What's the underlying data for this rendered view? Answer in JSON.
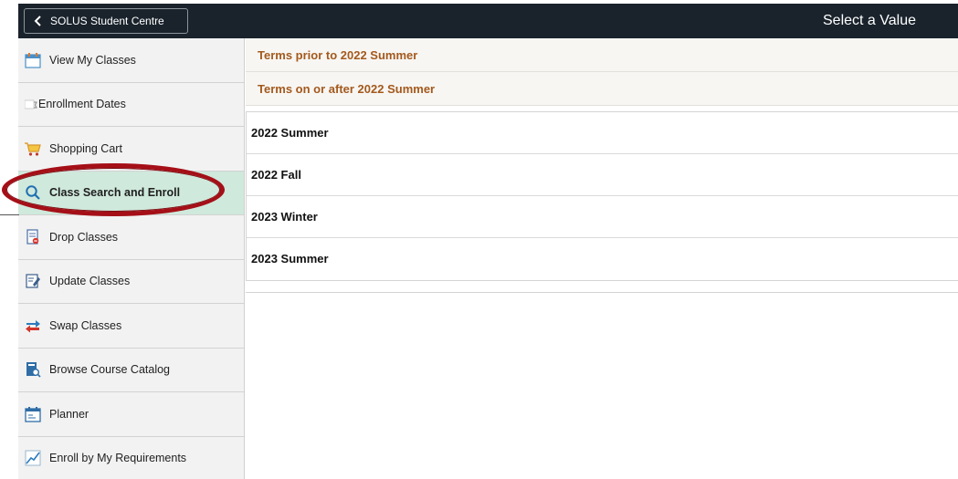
{
  "topbar": {
    "back_label": "SOLUS Student Centre",
    "title": "Select a Value"
  },
  "sidebar": {
    "items": [
      {
        "label": "View My Classes",
        "icon": "calendar-icon"
      },
      {
        "label": "Enrollment Dates",
        "icon": "hourglass-icon"
      },
      {
        "label": "Shopping Cart",
        "icon": "shopping-cart-icon"
      },
      {
        "label": "Class Search and Enroll",
        "icon": "search-icon"
      },
      {
        "label": "Drop Classes",
        "icon": "drop-document-icon"
      },
      {
        "label": "Update Classes",
        "icon": "edit-document-icon"
      },
      {
        "label": "Swap Classes",
        "icon": "swap-arrows-icon"
      },
      {
        "label": "Browse Course Catalog",
        "icon": "catalog-search-icon"
      },
      {
        "label": "Planner",
        "icon": "planner-icon"
      },
      {
        "label": "Enroll by My Requirements",
        "icon": "chart-line-icon"
      }
    ],
    "active_index": 3
  },
  "main": {
    "groups": [
      {
        "label": "Terms prior to 2022 Summer"
      },
      {
        "label": "Terms on or after 2022 Summer"
      }
    ],
    "terms": [
      "2022 Summer",
      "2022 Fall",
      "2023 Winter",
      "2023 Summer"
    ]
  },
  "colors": {
    "topbar": "#1a232c",
    "group_header_text": "#a4591c",
    "active_item_bg": "#cfe9dc",
    "highlight_oval": "#a50f17"
  }
}
